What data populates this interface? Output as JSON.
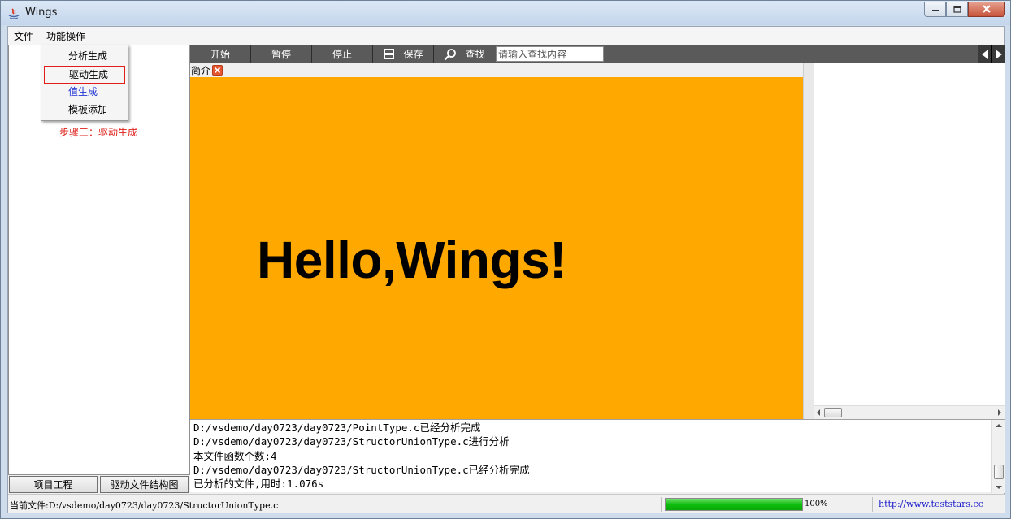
{
  "window": {
    "title": "Wings"
  },
  "menubar": {
    "file": "文件",
    "ops": "功能操作"
  },
  "dropdown": {
    "items": [
      "分析生成",
      "驱动生成",
      "值生成",
      "模板添加"
    ]
  },
  "left_panel": {
    "step_text": "步骤三：驱动生成",
    "btn_project": "项目工程",
    "btn_driver_tree": "驱动文件结构图"
  },
  "toolbar": {
    "start": "开始",
    "pause": "暂停",
    "stop": "停止",
    "save": "保存",
    "find": "查找",
    "search_placeholder": "请输入查找内容"
  },
  "tab": {
    "label": "简介"
  },
  "content": {
    "headline": "Hello,Wings!",
    "bg_color": "#ffa800"
  },
  "log": {
    "lines": [
      "D:/vsdemo/day0723/day0723/PointType.c已经分析完成",
      "D:/vsdemo/day0723/day0723/StructorUnionType.c进行分析",
      "本文件函数个数:4",
      "D:/vsdemo/day0723/day0723/StructorUnionType.c已经分析完成",
      "已分析的文件,用时:1.076s"
    ]
  },
  "status": {
    "current_file": "当前文件:D:/vsdemo/day0723/day0723/StructorUnionType.c",
    "progress_fraction": 1.0,
    "progress_text": "100%",
    "link": "http://www.teststars.cc"
  }
}
